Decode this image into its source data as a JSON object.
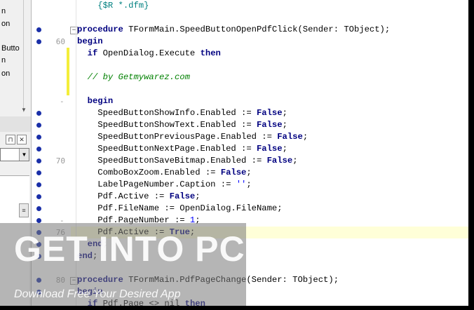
{
  "left_panel": {
    "items": [
      "n",
      "on",
      "Butto",
      "n",
      "on"
    ],
    "pin_icon": "pin-icon",
    "close_icon": "close-icon",
    "combo_arrow_icon": "chevron-down-icon",
    "arrow_icon": "chevron-down-icon",
    "scroll_icon": "scrollbar-grip-icon"
  },
  "editor": {
    "line_numbers": [
      {
        "label": "60",
        "row": 3
      },
      {
        "label": "-",
        "row": 8
      },
      {
        "label": "70",
        "row": 13
      },
      {
        "label": "-",
        "row": 18
      },
      {
        "label": "76",
        "row": 19
      },
      {
        "label": "80",
        "row": 23
      }
    ],
    "lines": [
      [
        {
          "t": "    "
        },
        {
          "t": "{$R *.dfm}",
          "c": "dr"
        }
      ],
      [
        {
          "t": ""
        }
      ],
      [
        {
          "t": "procedure",
          "c": "kw"
        },
        {
          "t": " TFormMain.SpeedButtonOpenPdfClick(Sender: TObject);"
        }
      ],
      [
        {
          "t": "begin",
          "c": "kw"
        }
      ],
      [
        {
          "t": "  "
        },
        {
          "t": "if",
          "c": "kw"
        },
        {
          "t": " OpenDialog.Execute "
        },
        {
          "t": "then",
          "c": "kw"
        }
      ],
      [
        {
          "t": ""
        }
      ],
      [
        {
          "t": "  "
        },
        {
          "t": "// by Getmywarez.com",
          "c": "cm"
        }
      ],
      [
        {
          "t": ""
        }
      ],
      [
        {
          "t": "  "
        },
        {
          "t": "begin",
          "c": "kw"
        }
      ],
      [
        {
          "t": "    SpeedButtonShowInfo.Enabled := "
        },
        {
          "t": "False",
          "c": "kw"
        },
        {
          "t": ";"
        }
      ],
      [
        {
          "t": "    SpeedButtonShowText.Enabled := "
        },
        {
          "t": "False",
          "c": "kw"
        },
        {
          "t": ";"
        }
      ],
      [
        {
          "t": "    SpeedButtonPreviousPage.Enabled := "
        },
        {
          "t": "False",
          "c": "kw"
        },
        {
          "t": ";"
        }
      ],
      [
        {
          "t": "    SpeedButtonNextPage.Enabled := "
        },
        {
          "t": "False",
          "c": "kw"
        },
        {
          "t": ";"
        }
      ],
      [
        {
          "t": "    SpeedButtonSaveBitmap.Enabled := "
        },
        {
          "t": "False",
          "c": "kw"
        },
        {
          "t": ";"
        }
      ],
      [
        {
          "t": "    ComboBoxZoom.Enabled := "
        },
        {
          "t": "False",
          "c": "kw"
        },
        {
          "t": ";"
        }
      ],
      [
        {
          "t": "    LabelPageNumber.Caption := "
        },
        {
          "t": "''",
          "c": "str"
        },
        {
          "t": ";"
        }
      ],
      [
        {
          "t": "    Pdf.Active := "
        },
        {
          "t": "False",
          "c": "kw"
        },
        {
          "t": ";"
        }
      ],
      [
        {
          "t": "    Pdf.FileName := OpenDialog.FileName;"
        }
      ],
      [
        {
          "t": "    Pdf.PageNumber := "
        },
        {
          "t": "1",
          "c": "num"
        },
        {
          "t": ";"
        }
      ],
      [
        {
          "t": "    Pdf.Active := "
        },
        {
          "t": "True",
          "c": "kw"
        },
        {
          "t": ";"
        }
      ],
      [
        {
          "t": "  "
        },
        {
          "t": "end",
          "c": "kw"
        },
        {
          "t": ";"
        }
      ],
      [
        {
          "t": "end",
          "c": "kw"
        },
        {
          "t": ";"
        }
      ],
      [
        {
          "t": ""
        }
      ],
      [
        {
          "t": "procedure",
          "c": "kw"
        },
        {
          "t": " TFormMain.PdfPageChange(Sender: TObject);"
        }
      ],
      [
        {
          "t": "begin",
          "c": "kw"
        }
      ],
      [
        {
          "t": "  "
        },
        {
          "t": "if",
          "c": "kw"
        },
        {
          "t": " Pdf.Page <> nil "
        },
        {
          "t": "then",
          "c": "kw"
        }
      ]
    ],
    "breakpoint_rows": [
      2,
      3,
      9,
      10,
      11,
      12,
      13,
      14,
      15,
      16,
      17,
      18,
      19,
      20,
      21,
      23,
      24
    ],
    "fold_rows": [
      2,
      23
    ],
    "modified_ranges": [
      [
        4,
        7
      ]
    ],
    "current_row": 19,
    "breakpoint_color": "#1a2fa8",
    "keyword_color": "#000080",
    "comment_color": "#008000"
  },
  "watermark": {
    "title": "GET INTO PC",
    "subtitle": "Download Free Your Desired App"
  }
}
